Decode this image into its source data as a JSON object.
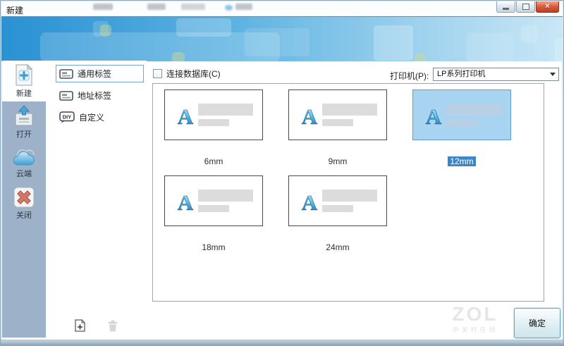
{
  "window": {
    "title": "新建",
    "close_glyph": "×"
  },
  "sidebar": {
    "items": [
      {
        "label": "新建"
      },
      {
        "label": "打开"
      },
      {
        "label": "云端"
      },
      {
        "label": "关闭"
      }
    ]
  },
  "categories": {
    "items": [
      {
        "label": "通用标签"
      },
      {
        "label": "地址标签"
      },
      {
        "label": "自定义"
      }
    ],
    "diy_icon_text": "DIY"
  },
  "toolbar": {
    "database_checkbox_label": "连接数据库(C)",
    "database_checked": false,
    "printer_label": "打印机(P):",
    "printer_selected": "LP系列打印机"
  },
  "templates": [
    {
      "size": "6mm",
      "selected": false
    },
    {
      "size": "9mm",
      "selected": false
    },
    {
      "size": "12mm",
      "selected": true
    },
    {
      "size": "18mm",
      "selected": false
    },
    {
      "size": "24mm",
      "selected": false
    }
  ],
  "template_icon": {
    "letter": "A"
  },
  "footer": {
    "ok_label": "确定",
    "watermark_title": "ZOL",
    "watermark_subtitle": "中关村在线"
  },
  "colors": {
    "banner_blue": "#2a91d3",
    "sidebar_bg": "#9db1c8",
    "selected_card_bg": "#a8d3f1",
    "selected_card_border": "#5f9fd0",
    "selection_highlight": "#3a86c8",
    "close_button_red": "#bf3c1f"
  }
}
